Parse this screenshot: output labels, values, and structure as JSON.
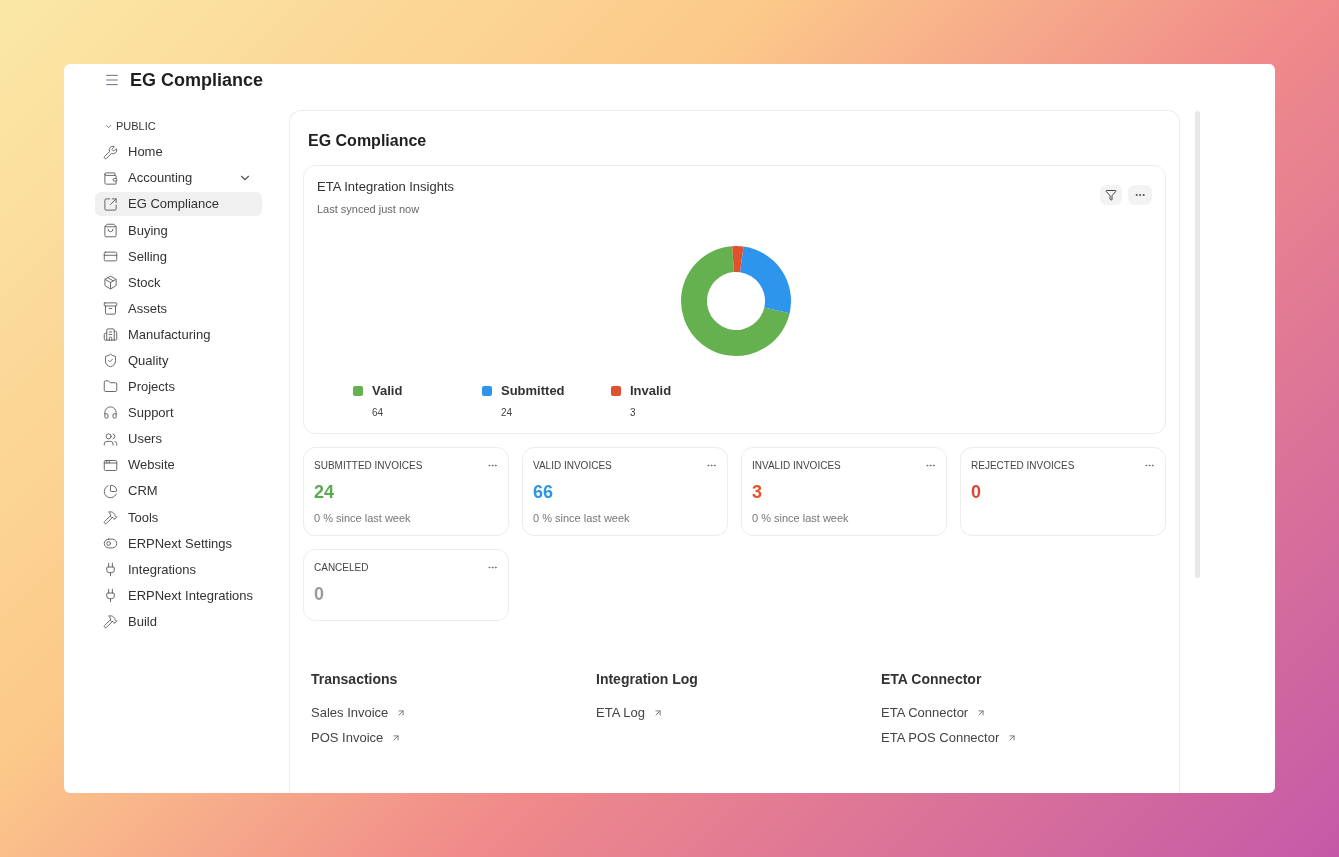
{
  "header": {
    "title": "EG Compliance"
  },
  "sidebar": {
    "section": "PUBLIC",
    "items": [
      {
        "label": "Home",
        "selected": false,
        "expandable": false
      },
      {
        "label": "Accounting",
        "selected": false,
        "expandable": true
      },
      {
        "label": "EG Compliance",
        "selected": true,
        "expandable": false
      },
      {
        "label": "Buying",
        "selected": false,
        "expandable": false
      },
      {
        "label": "Selling",
        "selected": false,
        "expandable": false
      },
      {
        "label": "Stock",
        "selected": false,
        "expandable": false
      },
      {
        "label": "Assets",
        "selected": false,
        "expandable": false
      },
      {
        "label": "Manufacturing",
        "selected": false,
        "expandable": false
      },
      {
        "label": "Quality",
        "selected": false,
        "expandable": false
      },
      {
        "label": "Projects",
        "selected": false,
        "expandable": false
      },
      {
        "label": "Support",
        "selected": false,
        "expandable": false
      },
      {
        "label": "Users",
        "selected": false,
        "expandable": false
      },
      {
        "label": "Website",
        "selected": false,
        "expandable": false
      },
      {
        "label": "CRM",
        "selected": false,
        "expandable": false
      },
      {
        "label": "Tools",
        "selected": false,
        "expandable": false
      },
      {
        "label": "ERPNext Settings",
        "selected": false,
        "expandable": false
      },
      {
        "label": "Integrations",
        "selected": false,
        "expandable": false
      },
      {
        "label": "ERPNext Integrations",
        "selected": false,
        "expandable": false
      },
      {
        "label": "Build",
        "selected": false,
        "expandable": false
      }
    ]
  },
  "workspace": {
    "title": "EG Compliance",
    "chart_card": {
      "title": "ETA Integration Insights",
      "subtitle": "Last synced just now",
      "legend_counts": [
        "64",
        "24",
        "3"
      ],
      "chart_data": {
        "type": "donut",
        "categories": [
          "Valid",
          "Submitted",
          "Invalid"
        ],
        "values": [
          70.33,
          26.37,
          3.3
        ],
        "colors": [
          "#65b04f",
          "#2d95ec",
          "#e0522d"
        ]
      }
    },
    "number_cards": [
      {
        "title": "SUBMITTED INVOICES",
        "value": "24",
        "color": "#5aab4f",
        "subtitle": "0 % since last week"
      },
      {
        "title": "VALID INVOICES",
        "value": "66",
        "color": "#2d95e6",
        "subtitle": "0 % since last week"
      },
      {
        "title": "INVALID INVOICES",
        "value": "3",
        "color": "#e2542b",
        "subtitle": "0 % since last week"
      },
      {
        "title": "REJECTED INVOICES",
        "value": "0",
        "color": "#d9463a"
      },
      {
        "title": "CANCELED",
        "value": "0",
        "color": "#9a9a9a"
      }
    ],
    "link_groups": [
      {
        "title": "Transactions",
        "links": [
          "Sales Invoice",
          "POS Invoice"
        ]
      },
      {
        "title": "Integration Log",
        "links": [
          "ETA Log"
        ]
      },
      {
        "title": "ETA Connector",
        "links": [
          "ETA Connector",
          "ETA POS Connector"
        ]
      }
    ]
  }
}
